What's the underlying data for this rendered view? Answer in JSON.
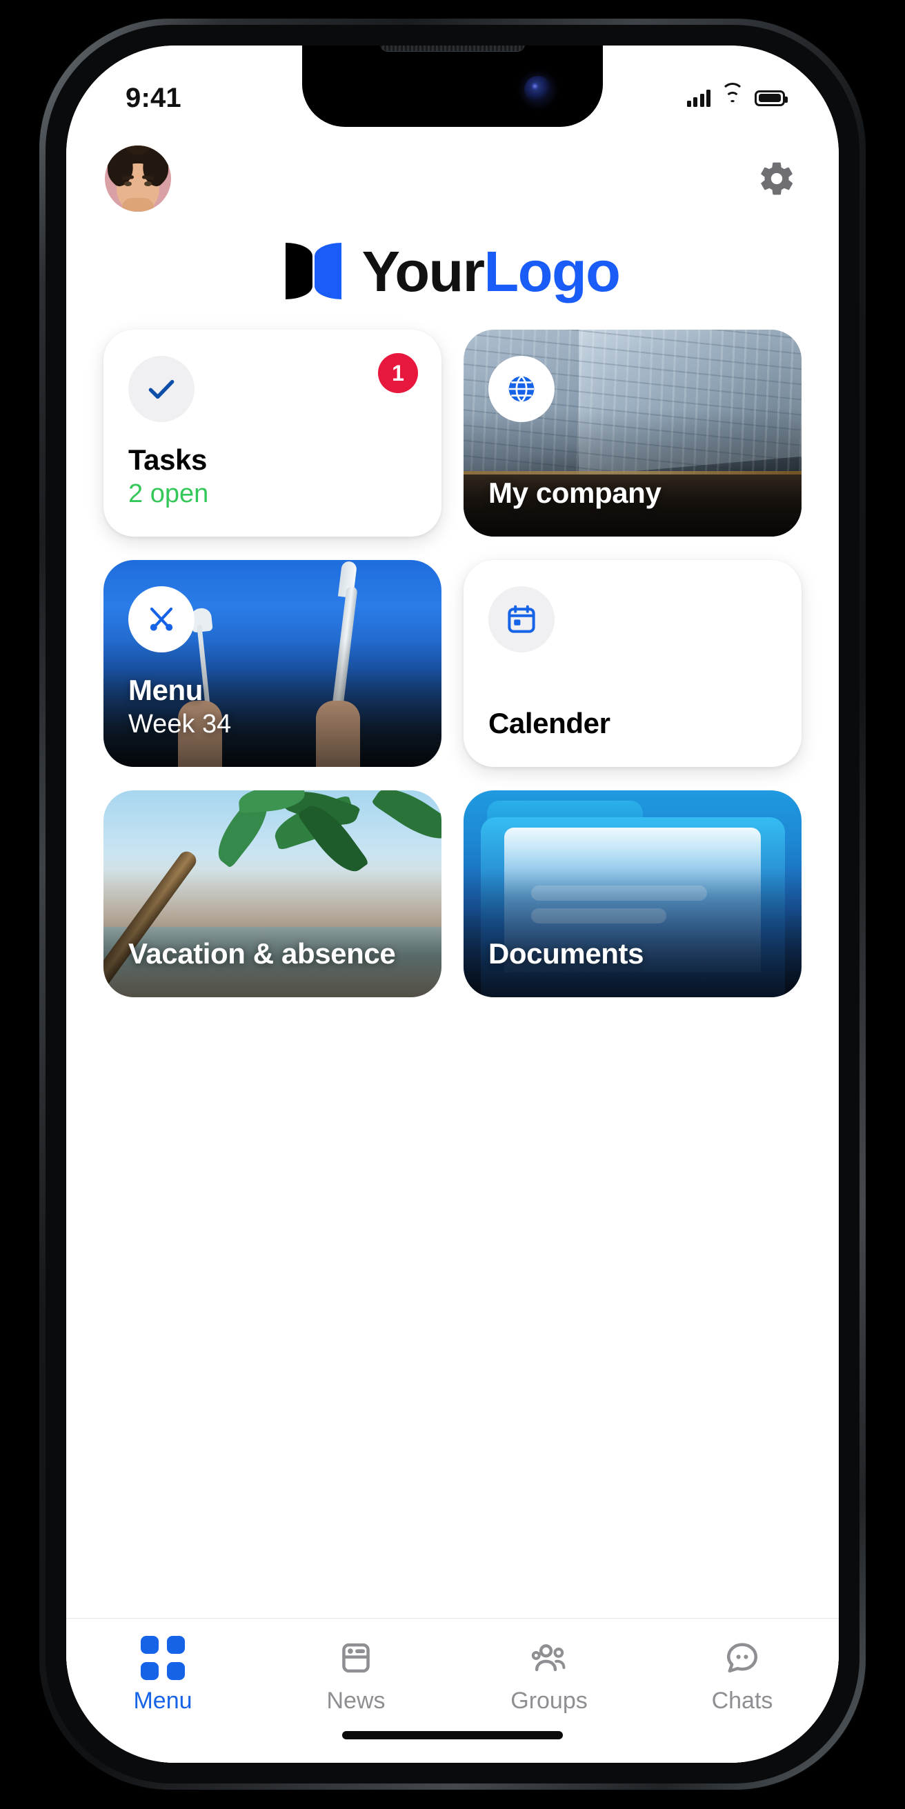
{
  "colors": {
    "brand_blue": "#1a5cf7",
    "tab_blue": "#1763e8",
    "check_blue": "#0d4fa8",
    "green": "#34c759",
    "red": "#e8173d",
    "gray_text": "#8e8e93",
    "icon_gray": "#6e6e73"
  },
  "status_bar": {
    "time": "9:41",
    "signal_icon": "cellular-signal-icon",
    "wifi_icon": "wifi-icon",
    "battery_icon": "battery-icon"
  },
  "header": {
    "avatar": "user-avatar",
    "settings_icon": "gear-icon"
  },
  "logo": {
    "mark": "brand-logo-mark",
    "text_primary": "Your",
    "text_secondary": "Logo"
  },
  "cards": [
    {
      "id": "tasks",
      "title": "Tasks",
      "subtitle": "2 open",
      "badge": "1",
      "icon": "checkmark-icon",
      "style": "light"
    },
    {
      "id": "my-company",
      "title": "My company",
      "subtitle": "",
      "badge": "",
      "icon": "globe-icon",
      "style": "dark"
    },
    {
      "id": "menu",
      "title": "Menu",
      "subtitle": "Week 34",
      "badge": "",
      "icon": "cutlery-icon",
      "style": "dark"
    },
    {
      "id": "calender",
      "title": "Calender",
      "subtitle": "",
      "badge": "",
      "icon": "calendar-icon",
      "style": "light"
    },
    {
      "id": "vacation-absence",
      "title": "Vacation & absence",
      "subtitle": "",
      "badge": "",
      "icon": "",
      "style": "dark"
    },
    {
      "id": "documents",
      "title": "Documents",
      "subtitle": "",
      "badge": "",
      "icon": "",
      "style": "dark"
    }
  ],
  "tabbar": {
    "items": [
      {
        "label": "Menu",
        "icon": "grid-dots-icon",
        "active": true
      },
      {
        "label": "News",
        "icon": "newspaper-icon",
        "active": false
      },
      {
        "label": "Groups",
        "icon": "people-group-icon",
        "active": false
      },
      {
        "label": "Chats",
        "icon": "chat-bubble-icon",
        "active": false
      }
    ]
  }
}
